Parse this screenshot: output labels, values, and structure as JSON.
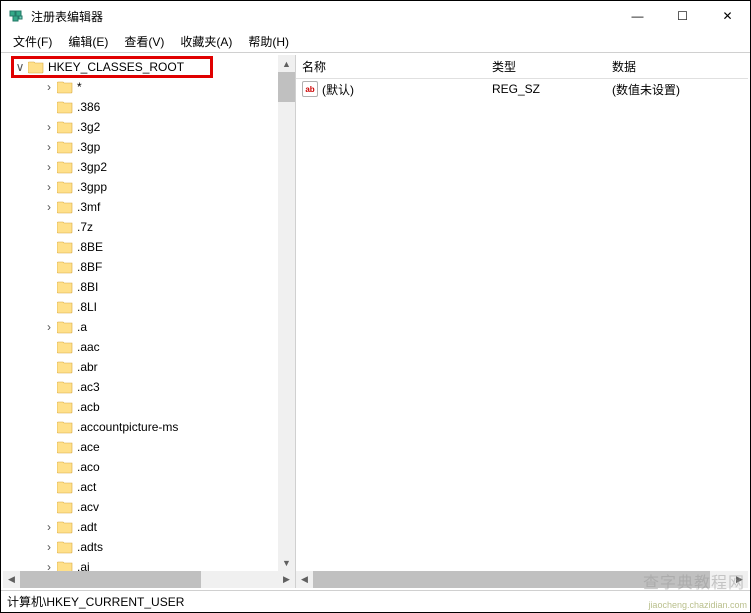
{
  "window": {
    "title": "注册表编辑器",
    "min": "—",
    "max": "☐",
    "close": "✕"
  },
  "menu": {
    "file": "文件(F)",
    "edit": "编辑(E)",
    "view": "查看(V)",
    "favorites": "收藏夹(A)",
    "help": "帮助(H)"
  },
  "tree": {
    "root": {
      "label": "HKEY_CLASSES_ROOT",
      "expander": "∨"
    },
    "items": [
      {
        "label": "*",
        "exp": "›"
      },
      {
        "label": ".386",
        "exp": ""
      },
      {
        "label": ".3g2",
        "exp": "›"
      },
      {
        "label": ".3gp",
        "exp": "›"
      },
      {
        "label": ".3gp2",
        "exp": "›"
      },
      {
        "label": ".3gpp",
        "exp": "›"
      },
      {
        "label": ".3mf",
        "exp": "›"
      },
      {
        "label": ".7z",
        "exp": ""
      },
      {
        "label": ".8BE",
        "exp": ""
      },
      {
        "label": ".8BF",
        "exp": ""
      },
      {
        "label": ".8BI",
        "exp": ""
      },
      {
        "label": ".8LI",
        "exp": ""
      },
      {
        "label": ".a",
        "exp": "›"
      },
      {
        "label": ".aac",
        "exp": ""
      },
      {
        "label": ".abr",
        "exp": ""
      },
      {
        "label": ".ac3",
        "exp": ""
      },
      {
        "label": ".acb",
        "exp": ""
      },
      {
        "label": ".accountpicture-ms",
        "exp": ""
      },
      {
        "label": ".ace",
        "exp": ""
      },
      {
        "label": ".aco",
        "exp": ""
      },
      {
        "label": ".act",
        "exp": ""
      },
      {
        "label": ".acv",
        "exp": ""
      },
      {
        "label": ".adt",
        "exp": "›"
      },
      {
        "label": ".adts",
        "exp": "›"
      },
      {
        "label": ".ai",
        "exp": "›"
      }
    ]
  },
  "list": {
    "columns": {
      "name": "名称",
      "type": "类型",
      "data": "数据"
    },
    "rows": [
      {
        "icon": "ab",
        "name": "(默认)",
        "type": "REG_SZ",
        "data": "(数值未设置)"
      }
    ]
  },
  "statusbar": {
    "path": "计算机\\HKEY_CURRENT_USER"
  },
  "watermark": {
    "text": "查字典教程网",
    "url": "jiaocheng.chazidian.com"
  }
}
